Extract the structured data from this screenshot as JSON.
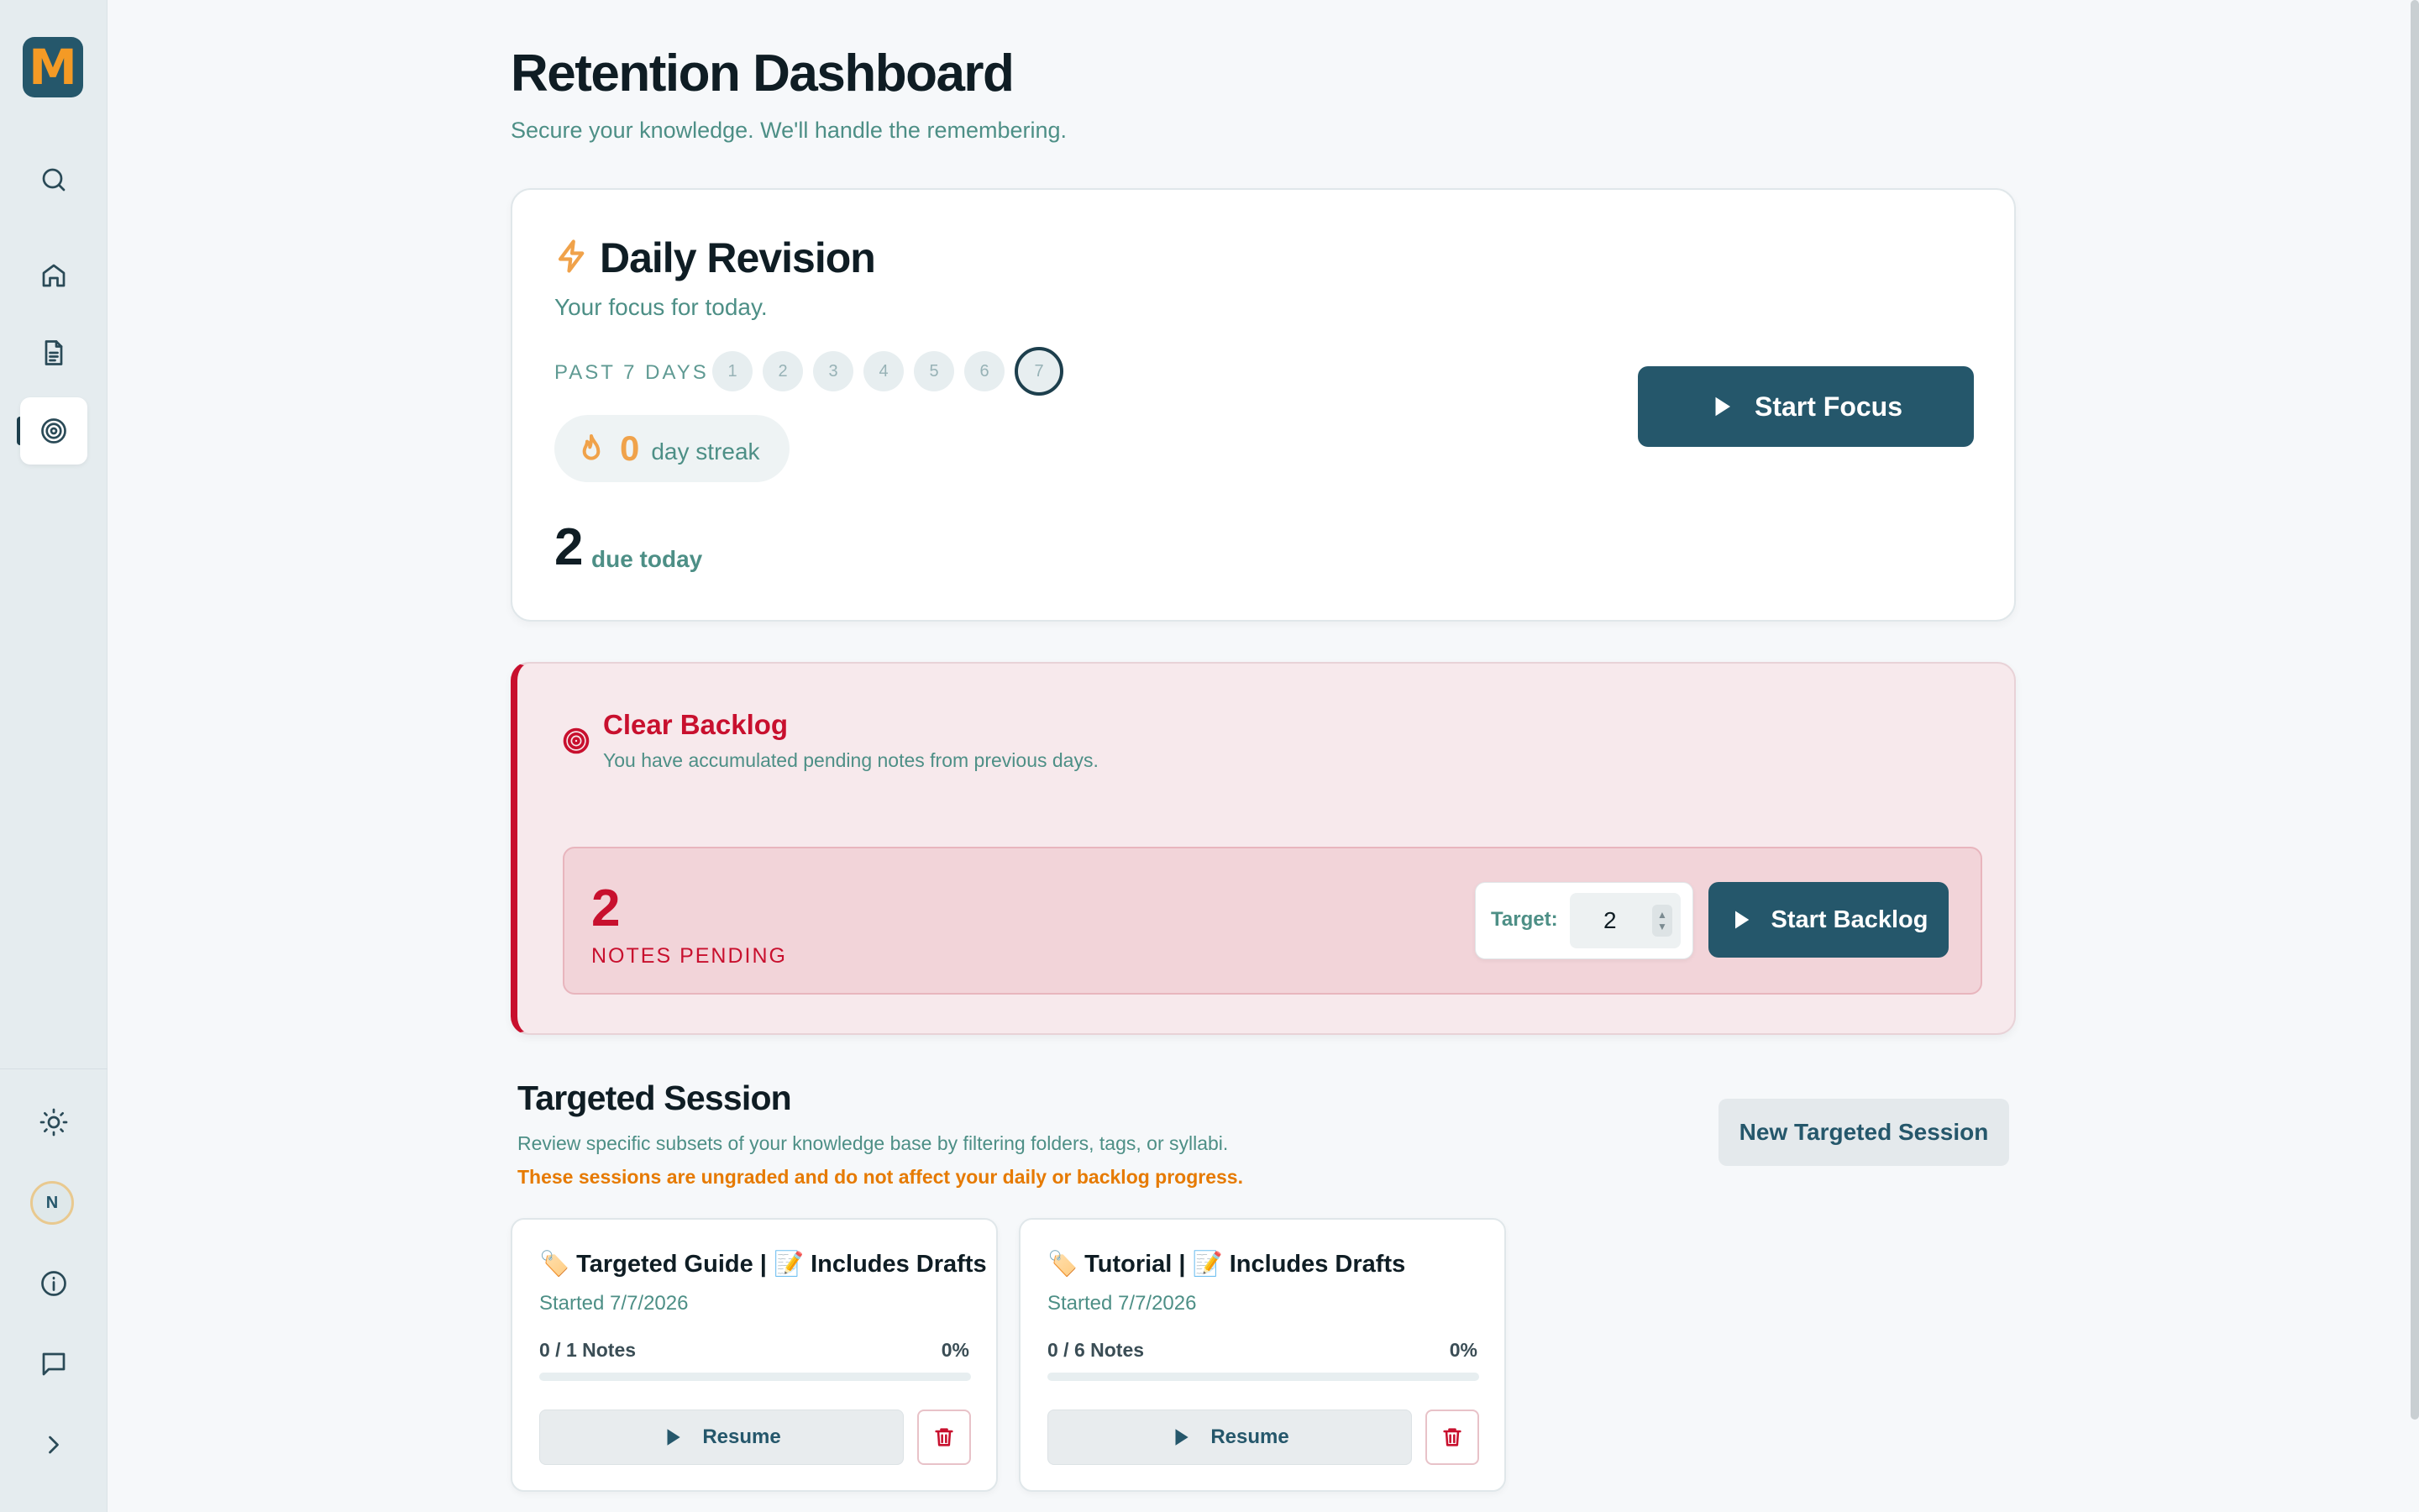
{
  "app": {
    "logo_letter": "M"
  },
  "sidebar": {
    "items": [
      {
        "name": "search",
        "icon": "search-icon"
      },
      {
        "name": "home",
        "icon": "home-icon"
      },
      {
        "name": "notes",
        "icon": "document-icon"
      },
      {
        "name": "retention",
        "icon": "target-icon",
        "active": true
      }
    ],
    "bottom": [
      {
        "name": "theme",
        "icon": "sun-icon"
      },
      {
        "name": "profile",
        "icon": "avatar"
      },
      {
        "name": "info",
        "icon": "info-icon"
      },
      {
        "name": "feedback",
        "icon": "message-icon"
      },
      {
        "name": "expand",
        "icon": "chevron-right-icon"
      }
    ],
    "avatar_initial": "N"
  },
  "header": {
    "title": "Retention Dashboard",
    "subtitle": "Secure your knowledge. We'll handle the remembering."
  },
  "daily": {
    "title": "Daily Revision",
    "subtitle": "Your focus for today.",
    "past_label": "PAST 7 DAYS",
    "days": [
      "1",
      "2",
      "3",
      "4",
      "5",
      "6",
      "7"
    ],
    "current_day": "7",
    "streak_value": "0",
    "streak_label": "day streak",
    "due_value": "2",
    "due_label": "due today",
    "start_label": "Start Focus"
  },
  "backlog": {
    "title": "Clear Backlog",
    "subtitle": "You have accumulated pending notes from previous days.",
    "pending_value": "2",
    "pending_label": "NOTES PENDING",
    "target_label": "Target:",
    "target_value": "2",
    "start_label": "Start Backlog"
  },
  "targeted": {
    "title": "Targeted Session",
    "subtitle": "Review specific subsets of your knowledge base by filtering folders, tags, or syllabi.",
    "warning": "These sessions are ungraded and do not affect your daily or backlog progress.",
    "new_label": "New Targeted Session",
    "sessions": [
      {
        "title": "🏷️ Targeted Guide | 📝 Includes Drafts",
        "started": "Started 7/7/2026",
        "notes": "0 / 1 Notes",
        "pct": "0%",
        "progress": 0,
        "resume_label": "Resume"
      },
      {
        "title": "🏷️ Tutorial | 📝 Includes Drafts",
        "started": "Started 7/7/2026",
        "notes": "0 / 6 Notes",
        "pct": "0%",
        "progress": 0,
        "resume_label": "Resume"
      }
    ]
  },
  "colors": {
    "primary": "#25576b",
    "accent": "#f0a24a",
    "danger": "#c8102e",
    "muted": "#4d8f86",
    "warning": "#e67a00"
  }
}
